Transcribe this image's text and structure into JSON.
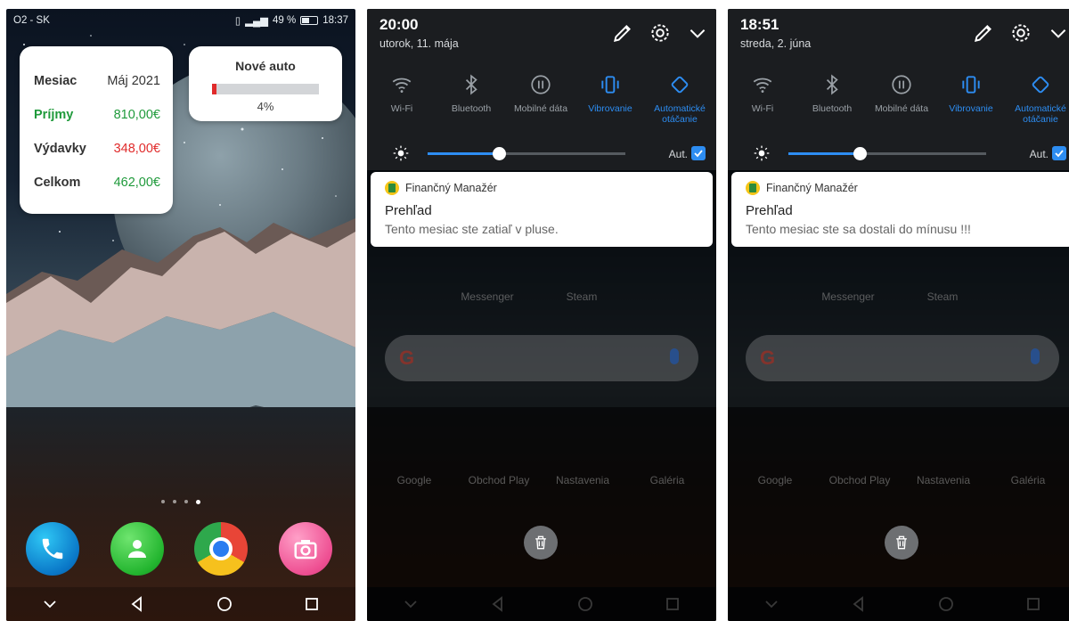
{
  "screen1": {
    "status": {
      "carrier": "O2 - SK",
      "battery": "49 %",
      "time": "18:37"
    },
    "summary_widget": {
      "rows": [
        {
          "label": "Mesiac",
          "value": "Máj 2021"
        },
        {
          "label": "Príjmy",
          "value": "810,00€"
        },
        {
          "label": "Výdavky",
          "value": "348,00€"
        },
        {
          "label": "Celkom",
          "value": "462,00€"
        }
      ]
    },
    "goal_widget": {
      "title": "Nové auto",
      "progress_percent": 4,
      "percent_label": "4%"
    },
    "dock_apps": [
      "phone-icon",
      "contacts-icon",
      "chrome-icon",
      "camera-icon"
    ]
  },
  "screen2": {
    "time": "20:00",
    "date": "utorok, 11. mája",
    "notification": {
      "app_name": "Finančný Manažér",
      "title": "Prehľad",
      "text": "Tento mesiac ste zatiaľ v pluse."
    }
  },
  "screen3": {
    "time": "18:51",
    "date": "streda, 2. júna",
    "notification": {
      "app_name": "Finančný Manažér",
      "title": "Prehľad",
      "text": "Tento mesiac ste sa dostali do mínusu !!!"
    }
  },
  "quick_toggles": [
    {
      "label": "Wi-Fi",
      "icon": "wifi-icon",
      "active": false
    },
    {
      "label": "Bluetooth",
      "icon": "bluetooth-icon",
      "active": false
    },
    {
      "label": "Mobilné dáta",
      "icon": "mobile-data-icon",
      "active": false
    },
    {
      "label": "Vibrovanie",
      "icon": "vibrate-icon",
      "active": true
    },
    {
      "label": "Automatické otáčanie",
      "icon": "auto-rotate-icon",
      "active": true
    }
  ],
  "brightness": {
    "auto_label": "Aut.",
    "level_percent": 36,
    "auto_checked": true
  },
  "home_labels": {
    "messenger": "Messenger",
    "steam": "Steam",
    "google": "Google",
    "play": "Obchod Play",
    "settings": "Nastavenia",
    "gallery": "Galéria"
  },
  "colors": {
    "accent": "#2d8df2",
    "income": "#1f9a3b",
    "expense": "#e02b2b"
  }
}
